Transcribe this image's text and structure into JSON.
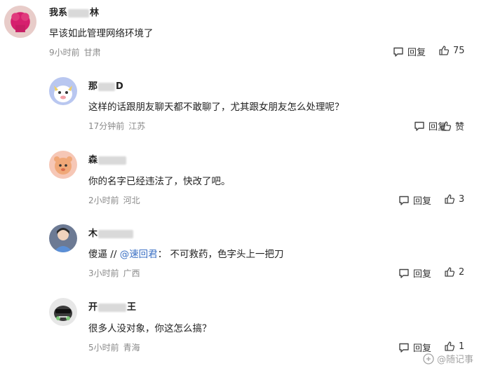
{
  "comments": [
    {
      "name_prefix": "我系",
      "name_suffix": "林",
      "text": "早该如此管理网络环境了",
      "time": "9小时前",
      "location": "甘肃",
      "reply_label": "回复",
      "like_label": "75"
    },
    {
      "name_prefix": "那",
      "name_suffix": "D",
      "text": "这样的话跟朋友聊天都不敢聊了，尤其跟女朋友怎么处理呢？",
      "time": "17分钟前",
      "location": "江苏",
      "reply_label": "回复",
      "like_label": "赞"
    },
    {
      "name_prefix": "森",
      "name_suffix": "",
      "text": "你的名字已经违法了，快改了吧。",
      "time": "2小时前",
      "location": "河北",
      "reply_label": "回复",
      "like_label": "3"
    },
    {
      "name_prefix": "木",
      "name_suffix": "",
      "text_prefix": "傻逼 // ",
      "mention": "@速回君",
      "text_suffix": "： 不可救药，色字头上一把刀",
      "time": "3小时前",
      "location": "广西",
      "reply_label": "回复",
      "like_label": "2"
    },
    {
      "name_prefix": "开",
      "name_suffix": "王",
      "text": "很多人没对象，你这怎么搞？",
      "time": "5小时前",
      "location": "青海",
      "reply_label": "回复",
      "like_label": "1"
    }
  ],
  "watermark": "@随记事",
  "icons": {
    "reply": "comment-bubble-icon",
    "like": "thumbs-up-icon"
  },
  "colors": {
    "mention": "#3a6fc4",
    "meta": "#8a8a8a"
  }
}
